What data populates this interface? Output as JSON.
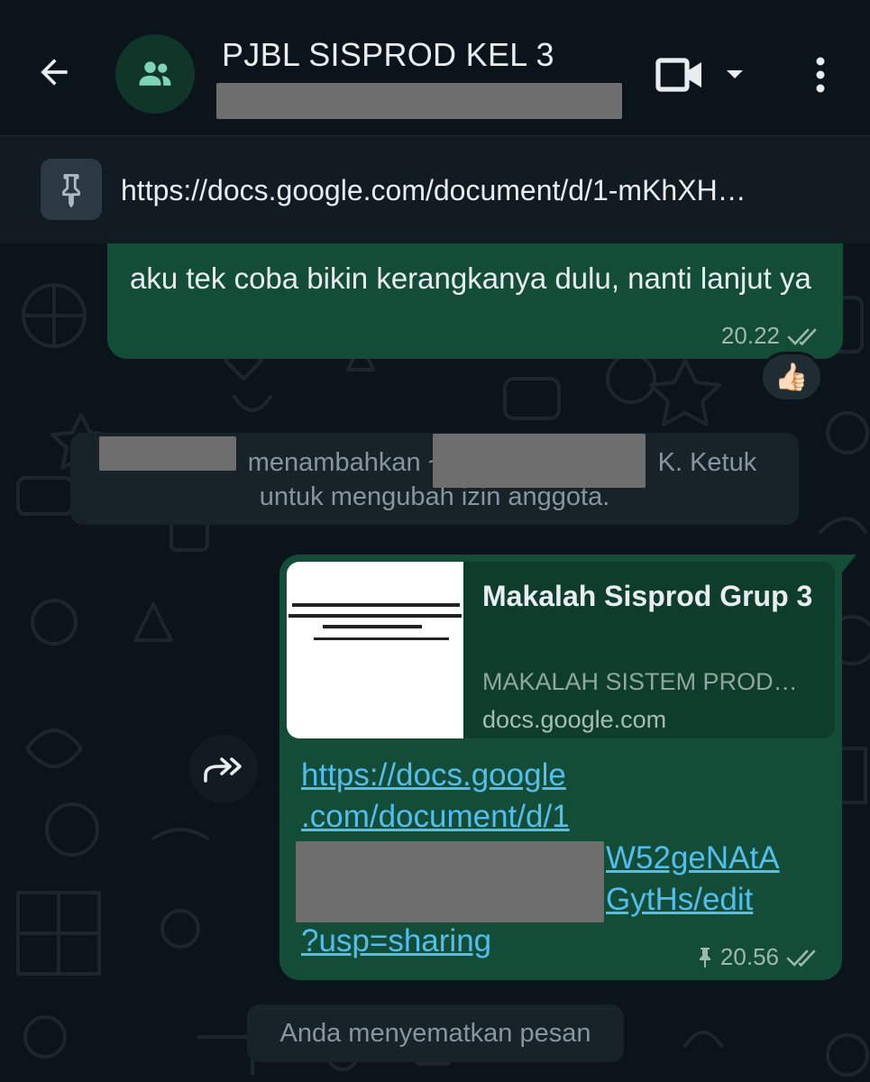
{
  "header": {
    "title": "PJBL SISPROD KEL 3",
    "icons": {
      "back": "arrow-left-icon",
      "avatar": "group-icon",
      "video": "video-camera-icon",
      "caret": "caret-down-icon",
      "menu": "more-vertical-icon"
    }
  },
  "pinned": {
    "icon": "pin-icon",
    "text": "https://docs.google.com/document/d/1-mKhXH…"
  },
  "messages": [
    {
      "type": "outgoing",
      "text": "aku tek coba bikin kerangkanya dulu, nanti lanjut ya",
      "time": "20.22",
      "status": "double-check-icon",
      "reaction": "👍🏻"
    },
    {
      "type": "system",
      "line1_mid": "menambahkan ~",
      "line1_end": "K. Ketuk",
      "line2": "untuk mengubah izin anggota."
    },
    {
      "type": "outgoing-link",
      "preview": {
        "title": "Makalah Sisprod Grup 3",
        "description": "MAKALAH SISTEM PROD…",
        "domain": "docs.google.com"
      },
      "link_lines": [
        "https://docs.google",
        ".com/document/d/1",
        "W52geNAtA",
        "GytHs/edit",
        "?usp=sharing"
      ],
      "time": "20.56",
      "pinned": true,
      "status": "double-check-icon"
    },
    {
      "type": "notice",
      "text": "Anda menyematkan pesan"
    }
  ],
  "colors": {
    "background": "#0b141a",
    "bubble_out": "#144d37",
    "link": "#53bdeb",
    "accent": "#25d366"
  }
}
